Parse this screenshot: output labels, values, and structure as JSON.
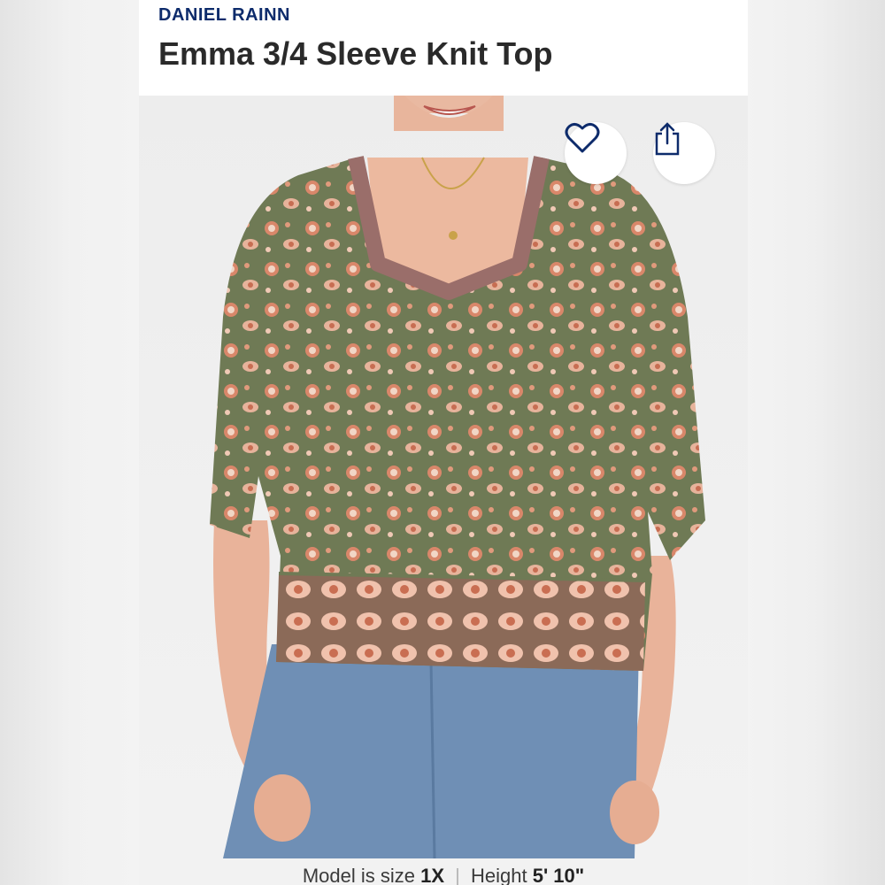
{
  "product": {
    "brand": "DANIEL RAINN",
    "title": "Emma 3/4 Sleeve Knit Top"
  },
  "actions": {
    "favorite_icon": "heart-icon",
    "share_icon": "share-icon"
  },
  "model_info": {
    "size_label": "Model is size",
    "size_value": "1X",
    "height_label": "Height",
    "height_value": "5' 10\""
  },
  "colors": {
    "brand": "#0d2b6b",
    "top_green": "#6f7a55",
    "print_coral": "#d9876a",
    "denim": "#6f8fb5"
  }
}
